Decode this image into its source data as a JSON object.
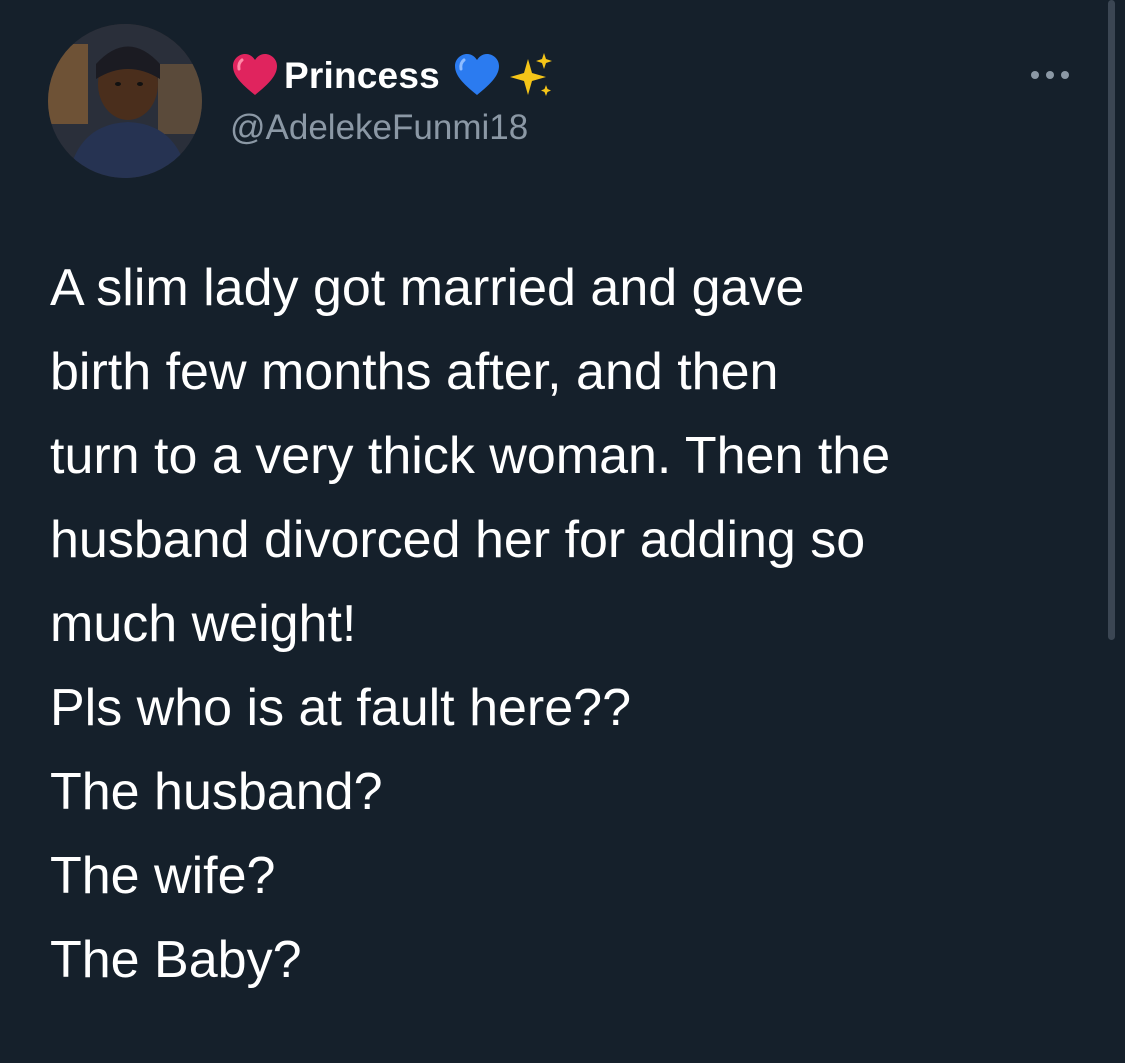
{
  "user": {
    "display_name": "Princess",
    "handle": "@AdelekeFunmi18",
    "name_emoji_before": "red-heart",
    "name_emoji_after": [
      "blue-heart",
      "sparkles"
    ]
  },
  "menu": {
    "icon": "more-horizontal-icon"
  },
  "tweet": {
    "lines": [
      "A slim lady got married and gave",
      "birth few months after, and then",
      "turn to a very thick woman. Then the",
      "husband divorced her for adding so",
      "much weight!",
      "Pls who is at fault here??",
      "The husband?",
      "The wife?",
      "The Baby?"
    ]
  },
  "colors": {
    "background": "#15202b",
    "text": "#ffffff",
    "secondary_text": "#8b98a5"
  }
}
